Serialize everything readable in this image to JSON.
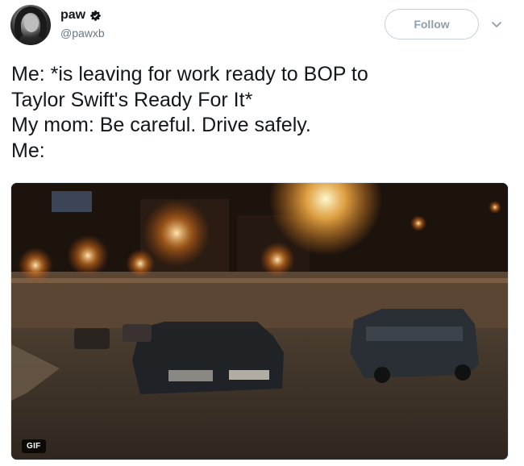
{
  "user": {
    "display_name": "paw",
    "handle": "@pawxb",
    "verified_icon": "verified-badge-icon"
  },
  "actions": {
    "follow_label": "Follow",
    "more_icon": "chevron-down-icon"
  },
  "tweet": {
    "lines": [
      "Me: *is leaving for work ready to BOP to",
      "Taylor Swift's Ready For It*",
      "My mom: Be careful. Drive safely.",
      "Me:"
    ]
  },
  "media": {
    "badge": "GIF",
    "description_icon": "gif-video-thumbnail"
  },
  "colors": {
    "text": "#14171a",
    "secondary": "#657786",
    "follow_border": "#c4d0da"
  }
}
